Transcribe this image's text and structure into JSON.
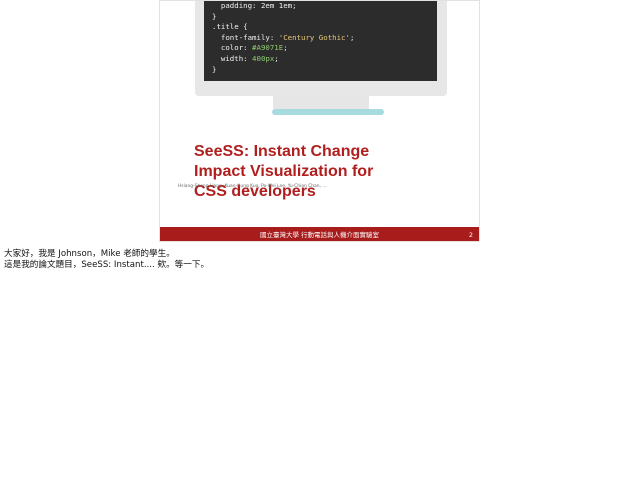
{
  "slide": {
    "code_lines": [
      {
        "plain": "  padding: 2em 1em;"
      },
      {
        "plain": "}"
      },
      {
        "plain": ".title {"
      },
      {
        "plain": "  font-family: ",
        "str": "'Century Gothic'",
        "tail": ";"
      },
      {
        "plain": "  color: ",
        "hex": "#A9071E",
        "tail": ";"
      },
      {
        "plain": "  width: ",
        "hex": "400px",
        "tail": ";"
      },
      {
        "plain": "}"
      }
    ],
    "title": "SeeSS: Instant Change Impact Visualization for CSS developers",
    "authors": "Hsiang-Sheng Liang, Kuan-Hung Kuo, Po-Wei Lee, Yu-Chien Chan, ...",
    "footer_text": "國立臺灣大學 行動電話與人機介面實驗室",
    "page_number": "2"
  },
  "notes": [
    "大家好，我是 Johnson，Mike 老師的學生。",
    "這是我的論文題目，SeeSS: Instant.... 欸。等一下。"
  ],
  "colors": {
    "accent": "#a81c1c",
    "title": "#b01e1e",
    "screen": "#2c2c2c",
    "stand_base": "#a6dbe0"
  }
}
